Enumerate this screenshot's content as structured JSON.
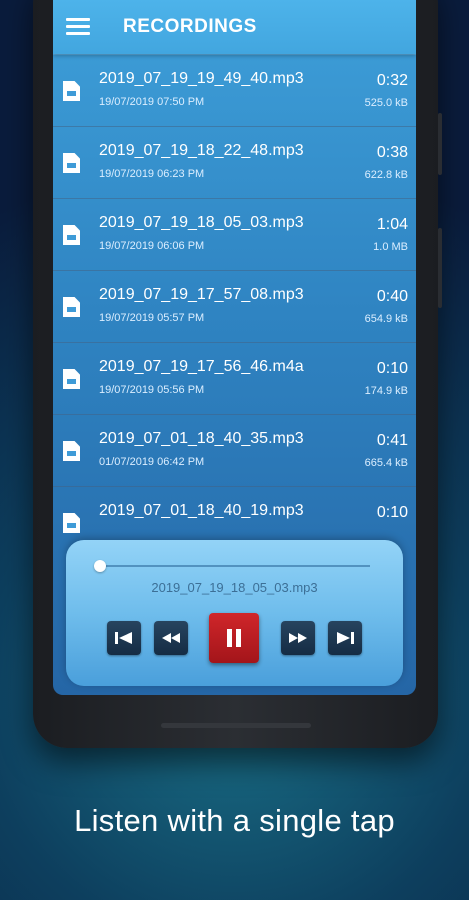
{
  "app": {
    "title": "RECORDINGS"
  },
  "icons": {
    "menu": "hamburger-menu-icon",
    "file": "audio-file-icon",
    "skip_previous": "skip-previous-icon",
    "rewind": "rewind-icon",
    "pause": "pause-icon",
    "fast_forward": "fast-forward-icon",
    "skip_next": "skip-next-icon"
  },
  "recordings": [
    {
      "name": "2019_07_19_19_49_40.mp3",
      "date": "19/07/2019 07:50 PM",
      "duration": "0:32",
      "size": "525.0 kB"
    },
    {
      "name": "2019_07_19_18_22_48.mp3",
      "date": "19/07/2019 06:23 PM",
      "duration": "0:38",
      "size": "622.8 kB"
    },
    {
      "name": "2019_07_19_18_05_03.mp3",
      "date": "19/07/2019 06:06 PM",
      "duration": "1:04",
      "size": "1.0 MB"
    },
    {
      "name": "2019_07_19_17_57_08.mp3",
      "date": "19/07/2019 05:57 PM",
      "duration": "0:40",
      "size": "654.9 kB"
    },
    {
      "name": "2019_07_19_17_56_46.m4a",
      "date": "19/07/2019 05:56 PM",
      "duration": "0:10",
      "size": "174.9 kB"
    },
    {
      "name": "2019_07_01_18_40_35.mp3",
      "date": "01/07/2019 06:42 PM",
      "duration": "0:41",
      "size": "665.4 kB"
    },
    {
      "name": "2019_07_01_18_40_19.mp3",
      "date": "",
      "duration": "0:10",
      "size": ""
    }
  ],
  "player": {
    "now_playing": "2019_07_19_18_05_03.mp3",
    "progress": 0.0
  },
  "caption": "Listen with a single tap",
  "colors": {
    "accent": "#42a6df",
    "pause_button": "#c41f24",
    "control_button": "#1d3852"
  }
}
